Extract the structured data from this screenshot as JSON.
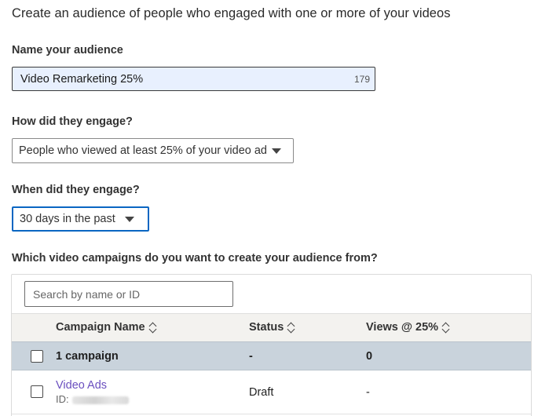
{
  "page": {
    "title": "Create an audience of people who engaged with one or more of your videos"
  },
  "audience_name": {
    "label": "Name your audience",
    "value": "Video Remarketing 25%",
    "char_count": "179"
  },
  "engagement": {
    "label": "How did they engage?",
    "selected": "People who viewed at least 25% of your video ad"
  },
  "timeframe": {
    "label": "When did they engage?",
    "selected": "30 days in the past"
  },
  "campaigns": {
    "label": "Which video campaigns do you want to create your audience from?",
    "search_placeholder": "Search by name or ID",
    "columns": [
      {
        "label": "Campaign Name"
      },
      {
        "label": "Status"
      },
      {
        "label": "Views @ 25%"
      }
    ],
    "summary": {
      "label": "1 campaign",
      "status": "-",
      "views": "0"
    },
    "rows": [
      {
        "name": "Video Ads",
        "id_label": "ID:",
        "status": "Draft",
        "views": "-"
      }
    ]
  },
  "colors": {
    "accent": "#0a66c2",
    "link": "#6a4fbf",
    "input_fill": "#e8f0fe",
    "summary_row": "#c9d3dc",
    "header_row": "#f3f2ef"
  },
  "icons": {
    "select_caret": "caret-down-icon",
    "sort": "sort-icon",
    "checkbox": "checkbox-icon"
  }
}
